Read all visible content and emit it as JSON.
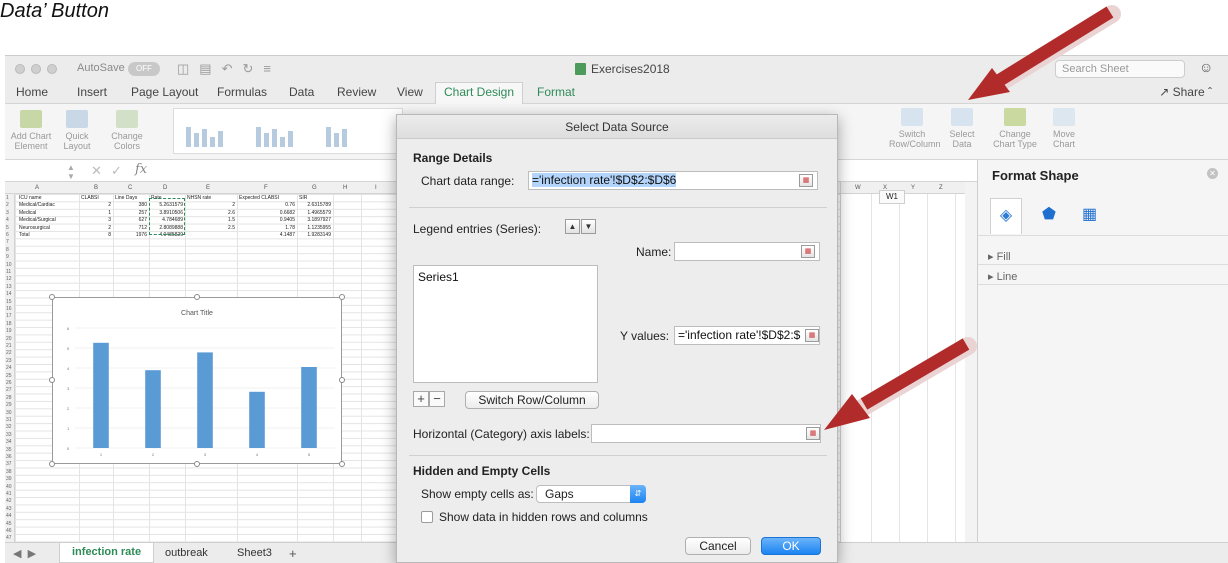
{
  "caption": "Data’ Button",
  "window": {
    "autosave_label": "AutoSave",
    "autosave_toggle": "OFF",
    "doc_title": "Exercises2018",
    "search_placeholder": "Search Sheet",
    "share_label": "Share"
  },
  "menu_tabs": [
    "Home",
    "Insert",
    "Page Layout",
    "Formulas",
    "Data",
    "Review",
    "View",
    "Chart Design",
    "Format"
  ],
  "ribbon": {
    "add_chart_element": [
      "Add Chart",
      "Element"
    ],
    "quick_layout": [
      "Quick",
      "Layout"
    ],
    "change_colors": [
      "Change",
      "Colors"
    ],
    "switch_row_column": [
      "Switch",
      "Row/Column"
    ],
    "select_data": [
      "Select",
      "Data"
    ],
    "change_chart_type": [
      "Change",
      "Chart Type"
    ],
    "move_chart": [
      "Move",
      "Chart"
    ]
  },
  "formula_bar": {
    "fx": "fx"
  },
  "sheet": {
    "columns": [
      "A",
      "B",
      "C",
      "D",
      "E",
      "F",
      "G",
      "H",
      "I",
      "W",
      "X",
      "Y",
      "Z"
    ],
    "header_row": [
      "ICU name",
      "CLABSI",
      "Line Days",
      "Rate",
      "NHSN rate",
      "Expected CLABSI",
      "SIR"
    ],
    "rows": [
      [
        "Medical/Cardiac",
        "2",
        "380",
        "5.2631579",
        "2",
        "0.76",
        "2.6315789"
      ],
      [
        "Medical",
        "1",
        "257",
        "3.8910506",
        "2.6",
        "0.6682",
        "1.4965579"
      ],
      [
        "Medical/Surgical",
        "3",
        "627",
        "4.784689",
        "1.5",
        "0.9405",
        "3.1897927"
      ],
      [
        "Neurosurgical",
        "2",
        "712",
        "2.8089888",
        "2.5",
        "1.78",
        "1.1235955"
      ],
      [
        "Total",
        "8",
        "1976",
        "4.0485829",
        "",
        "4.1487",
        "1.9283149"
      ]
    ],
    "w1_cell": "W1"
  },
  "chart_data": {
    "type": "bar",
    "title": "Chart Title",
    "categories": [
      "1",
      "2",
      "3",
      "4",
      "5"
    ],
    "values": [
      5.26,
      3.89,
      4.78,
      2.81,
      4.05
    ],
    "ylim": [
      0,
      6
    ],
    "yticks": [
      "0",
      "1",
      "2",
      "3",
      "4",
      "5",
      "6"
    ],
    "bar_color": "#5b9bd5"
  },
  "sheet_tabs": [
    "infection rate",
    "outbreak",
    "Sheet3"
  ],
  "format_pane": {
    "title": "Format Shape",
    "fill_label": "Fill",
    "line_label": "Line"
  },
  "dialog": {
    "title": "Select Data Source",
    "range_details": "Range Details",
    "chart_data_range_label": "Chart data range:",
    "chart_data_range_value": "='infection rate'!$D$2:$D$6",
    "legend_entries_label": "Legend entries (Series):",
    "series": [
      "Series1"
    ],
    "name_label": "Name:",
    "name_value": "",
    "y_values_label": "Y values:",
    "y_values_value": "='infection rate'!$D$2:$",
    "switch_button": "Switch Row/Column",
    "category_label": "Horizontal (Category) axis labels:",
    "category_value": "",
    "hidden_empty_header": "Hidden and Empty Cells",
    "show_empty_label": "Show empty cells as:",
    "show_empty_value": "Gaps",
    "show_hidden_label": "Show data in hidden rows and columns",
    "cancel": "Cancel",
    "ok": "OK"
  }
}
